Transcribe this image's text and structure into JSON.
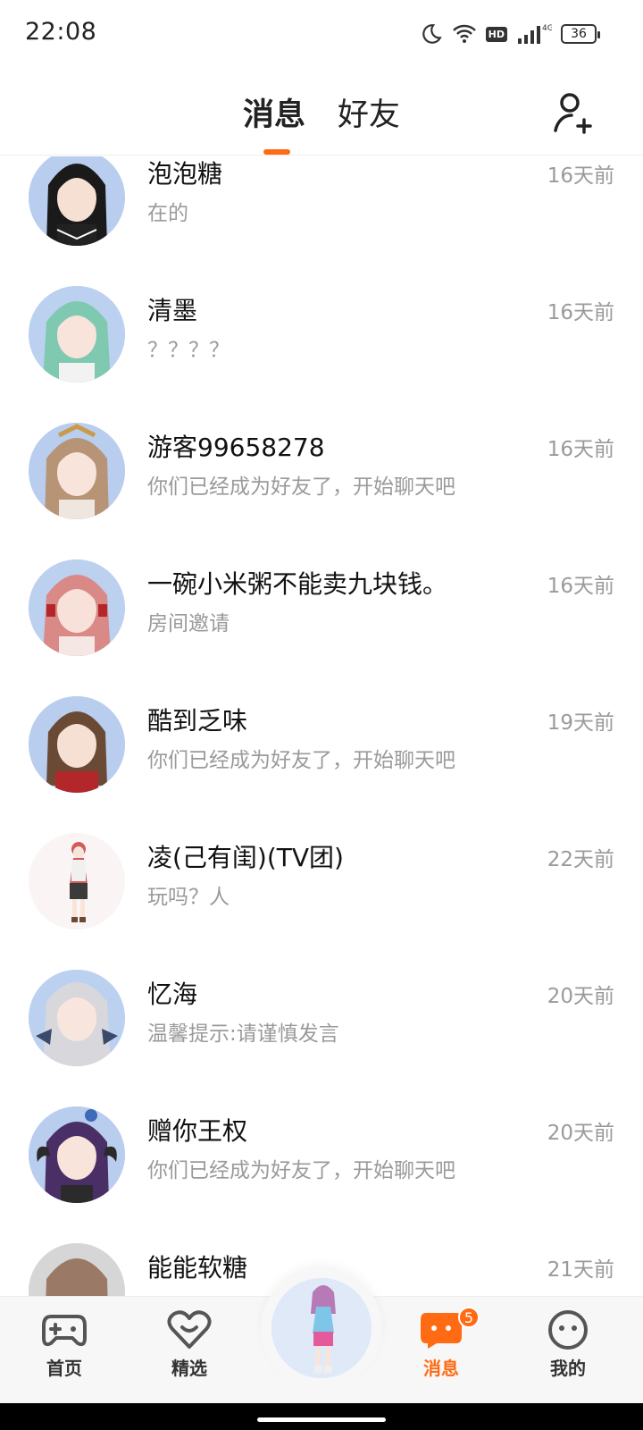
{
  "status_bar": {
    "time": "22:08",
    "network": "4G",
    "hd": "HD",
    "battery": "36"
  },
  "header": {
    "tabs": [
      {
        "label": "消息",
        "active": true
      },
      {
        "label": "好友",
        "active": false
      }
    ],
    "add_friend_icon": "add-user-icon",
    "accent_color": "#ff6a13"
  },
  "conversations": [
    {
      "name": "泡泡糖",
      "preview": "在的",
      "time": "16天前"
    },
    {
      "name": "清墨",
      "preview": "？？？？",
      "time": "16天前"
    },
    {
      "name": "游客99658278",
      "preview": "你们已经成为好友了，开始聊天吧",
      "time": "16天前"
    },
    {
      "name": "一碗小米粥不能卖九块钱。",
      "preview": "房间邀请",
      "time": "16天前"
    },
    {
      "name": "酷到乏味",
      "preview": "你们已经成为好友了，开始聊天吧",
      "time": "19天前"
    },
    {
      "name": "凌(己有闺)(TV团)",
      "preview": "玩吗？人",
      "time": "22天前"
    },
    {
      "name": "忆海",
      "preview": "温馨提示:请谨慎发言",
      "time": "20天前"
    },
    {
      "name": "赠你王权",
      "preview": "你们已经成为好友了，开始聊天吧",
      "time": "20天前"
    },
    {
      "name": "能能软糖",
      "preview": "",
      "time": "21天前"
    }
  ],
  "bottom_nav": {
    "items": [
      {
        "label": "首页",
        "icon": "gamepad-icon"
      },
      {
        "label": "精选",
        "icon": "heart-icon"
      },
      {
        "label": "消息",
        "icon": "chat-bubble-icon",
        "badge": "5",
        "active": true
      },
      {
        "label": "我的",
        "icon": "face-icon"
      }
    ]
  }
}
